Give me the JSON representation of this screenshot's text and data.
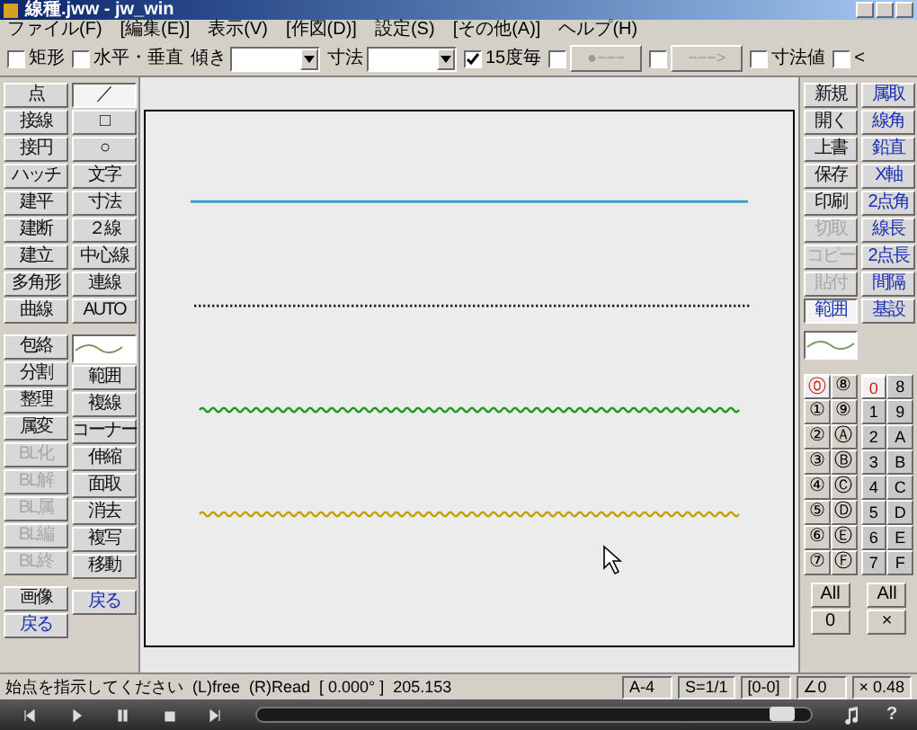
{
  "window": {
    "title": "線種.jww - jw_win"
  },
  "menu": [
    "ファイル(F)",
    "[編集(E)]",
    "表示(V)",
    "[作図(D)]",
    "設定(S)",
    "[その他(A)]",
    "ヘルプ(H)"
  ],
  "toolbar": [
    {
      "kind": "checkbox",
      "label": "矩形",
      "checked": false
    },
    {
      "kind": "checkbox",
      "label": "水平・垂直",
      "checked": false
    },
    {
      "kind": "combo",
      "label": "傾き"
    },
    {
      "kind": "combo",
      "label": "寸法"
    },
    {
      "kind": "checkbox",
      "label": "15度毎",
      "checked": true
    },
    {
      "kind": "checkbutton",
      "label": "●−−−",
      "checked": false
    },
    {
      "kind": "checkbutton",
      "label": "−−−>",
      "checked": false
    },
    {
      "kind": "checkbox",
      "label": "寸法値",
      "checked": false
    },
    {
      "kind": "checkbox",
      "label": "<",
      "checked": false
    }
  ],
  "left_panel": [
    [
      [
        {
          "label": "点",
          "selected": false,
          "disabled": false,
          "accent": false
        },
        {
          "label": "接線",
          "selected": false,
          "disabled": false,
          "accent": false
        },
        {
          "label": "接円",
          "selected": false,
          "disabled": false,
          "accent": false
        },
        {
          "label": "ハッチ",
          "selected": false,
          "disabled": false,
          "accent": false
        },
        {
          "label": "建平",
          "selected": false,
          "disabled": false,
          "accent": false
        },
        {
          "label": "建断",
          "selected": false,
          "disabled": false,
          "accent": false
        },
        {
          "label": "建立",
          "selected": false,
          "disabled": false,
          "accent": false
        },
        {
          "label": "多角形",
          "selected": false,
          "disabled": false,
          "accent": false
        },
        {
          "label": "曲線",
          "selected": false,
          "disabled": false,
          "accent": false
        }
      ],
      [
        {
          "label": "包絡",
          "selected": false,
          "disabled": false,
          "accent": false
        },
        {
          "label": "分割",
          "selected": false,
          "disabled": false,
          "accent": false
        },
        {
          "label": "整理",
          "selected": false,
          "disabled": false,
          "accent": false
        },
        {
          "label": "属変",
          "selected": false,
          "disabled": false,
          "accent": false
        },
        {
          "label": "BL化",
          "selected": false,
          "disabled": true,
          "accent": false
        },
        {
          "label": "BL解",
          "selected": false,
          "disabled": true,
          "accent": false
        },
        {
          "label": "BL属",
          "selected": false,
          "disabled": true,
          "accent": false
        },
        {
          "label": "BL編",
          "selected": false,
          "disabled": true,
          "accent": false
        },
        {
          "label": "BL終",
          "selected": false,
          "disabled": true,
          "accent": false
        }
      ],
      [
        {
          "label": "画像",
          "selected": false,
          "disabled": false,
          "accent": false
        },
        {
          "label": "戻る",
          "selected": false,
          "disabled": false,
          "accent": true
        }
      ]
    ],
    [
      [
        {
          "label": "／",
          "selected": true,
          "disabled": false,
          "accent": false
        },
        {
          "label": "□",
          "selected": false,
          "disabled": false,
          "accent": false
        },
        {
          "label": "○",
          "selected": false,
          "disabled": false,
          "accent": false
        },
        {
          "label": "文字",
          "selected": false,
          "disabled": false,
          "accent": false
        },
        {
          "label": "寸法",
          "selected": false,
          "disabled": false,
          "accent": false
        },
        {
          "label": "２線",
          "selected": false,
          "disabled": false,
          "accent": false
        },
        {
          "label": "中心線",
          "selected": false,
          "disabled": false,
          "accent": false
        },
        {
          "label": "連線",
          "selected": false,
          "disabled": false,
          "accent": false
        },
        {
          "label": "AUTO",
          "selected": false,
          "disabled": false,
          "accent": false
        }
      ],
      [
        {
          "kind": "preview"
        },
        {
          "label": "範囲",
          "selected": false,
          "disabled": false,
          "accent": false
        },
        {
          "label": "複線",
          "selected": false,
          "disabled": false,
          "accent": false
        },
        {
          "label": "コーナー",
          "selected": false,
          "disabled": false,
          "accent": false
        },
        {
          "label": "伸縮",
          "selected": false,
          "disabled": false,
          "accent": false
        },
        {
          "label": "面取",
          "selected": false,
          "disabled": false,
          "accent": false
        },
        {
          "label": "消去",
          "selected": false,
          "disabled": false,
          "accent": false
        },
        {
          "label": "複写",
          "selected": false,
          "disabled": false,
          "accent": false
        },
        {
          "label": "移動",
          "selected": false,
          "disabled": false,
          "accent": false
        }
      ],
      [
        {
          "label": "戻る",
          "selected": false,
          "disabled": false,
          "accent": true
        }
      ]
    ]
  ],
  "right_panel": [
    [
      {
        "label": "新規",
        "selected": false,
        "disabled": false,
        "accent": false
      },
      {
        "label": "開く",
        "selected": false,
        "disabled": false,
        "accent": false
      },
      {
        "label": "上書",
        "selected": false,
        "disabled": false,
        "accent": false
      },
      {
        "label": "保存",
        "selected": false,
        "disabled": false,
        "accent": false
      },
      {
        "label": "印刷",
        "selected": false,
        "disabled": false,
        "accent": false
      },
      {
        "label": "切取",
        "selected": false,
        "disabled": true,
        "accent": false
      },
      {
        "label": "コピー",
        "selected": false,
        "disabled": true,
        "accent": false
      },
      {
        "label": "貼付",
        "selected": false,
        "disabled": true,
        "accent": false
      },
      {
        "label": "範囲",
        "selected": true,
        "disabled": false,
        "accent": true
      }
    ],
    [
      {
        "label": "属取",
        "selected": false,
        "disabled": false,
        "accent": true
      },
      {
        "label": "線角",
        "selected": false,
        "disabled": false,
        "accent": true
      },
      {
        "label": "鉛直",
        "selected": false,
        "disabled": false,
        "accent": true
      },
      {
        "label": "X軸",
        "selected": false,
        "disabled": false,
        "accent": true
      },
      {
        "label": "2点角",
        "selected": false,
        "disabled": false,
        "accent": true
      },
      {
        "label": "線長",
        "selected": false,
        "disabled": false,
        "accent": true
      },
      {
        "label": "2点長",
        "selected": false,
        "disabled": false,
        "accent": true
      },
      {
        "label": "間隔",
        "selected": false,
        "disabled": false,
        "accent": true
      },
      {
        "label": "基設",
        "selected": false,
        "disabled": false,
        "accent": true
      }
    ]
  ],
  "layer_groups": [
    {
      "label": "⓪",
      "selected": true
    },
    {
      "label": "⑧",
      "selected": false
    },
    {
      "label": "①",
      "selected": false
    },
    {
      "label": "⑨",
      "selected": false
    },
    {
      "label": "②",
      "selected": false
    },
    {
      "label": "Ⓐ",
      "selected": false
    },
    {
      "label": "③",
      "selected": false
    },
    {
      "label": "Ⓑ",
      "selected": false
    },
    {
      "label": "④",
      "selected": false
    },
    {
      "label": "Ⓒ",
      "selected": false
    },
    {
      "label": "⑤",
      "selected": false
    },
    {
      "label": "Ⓓ",
      "selected": false
    },
    {
      "label": "⑥",
      "selected": false
    },
    {
      "label": "Ⓔ",
      "selected": false
    },
    {
      "label": "⑦",
      "selected": false
    },
    {
      "label": "Ⓕ",
      "selected": false
    }
  ],
  "layers": [
    {
      "label": "0",
      "selected": true
    },
    {
      "label": "8",
      "selected": false
    },
    {
      "label": "1",
      "selected": false
    },
    {
      "label": "9",
      "selected": false
    },
    {
      "label": "2",
      "selected": false
    },
    {
      "label": "A",
      "selected": false
    },
    {
      "label": "3",
      "selected": false
    },
    {
      "label": "B",
      "selected": false
    },
    {
      "label": "4",
      "selected": false
    },
    {
      "label": "C",
      "selected": false
    },
    {
      "label": "5",
      "selected": false
    },
    {
      "label": "D",
      "selected": false
    },
    {
      "label": "6",
      "selected": false
    },
    {
      "label": "E",
      "selected": false
    },
    {
      "label": "7",
      "selected": false
    },
    {
      "label": "F",
      "selected": false
    }
  ],
  "layer_buttons": [
    {
      "label": "All"
    },
    {
      "label": "All"
    },
    {
      "label": "0"
    },
    {
      "label": "×"
    }
  ],
  "canvas_lines": [
    {
      "kind": "solid",
      "color": "#2a9fd0"
    },
    {
      "kind": "dotted",
      "color": "#222222"
    },
    {
      "kind": "wavy",
      "color": "#1e9a1e"
    },
    {
      "kind": "wavy",
      "color": "#c8a000"
    }
  ],
  "status_bar": {
    "message": "始点を指示してください  (L)free  (R)Read  [ 0.000° ]  205.153",
    "fields": [
      "A-4",
      "S=1/1",
      "[0-0]",
      "∠0",
      "× 0.48"
    ]
  },
  "player": {
    "level": 0.97,
    "help": "?"
  }
}
